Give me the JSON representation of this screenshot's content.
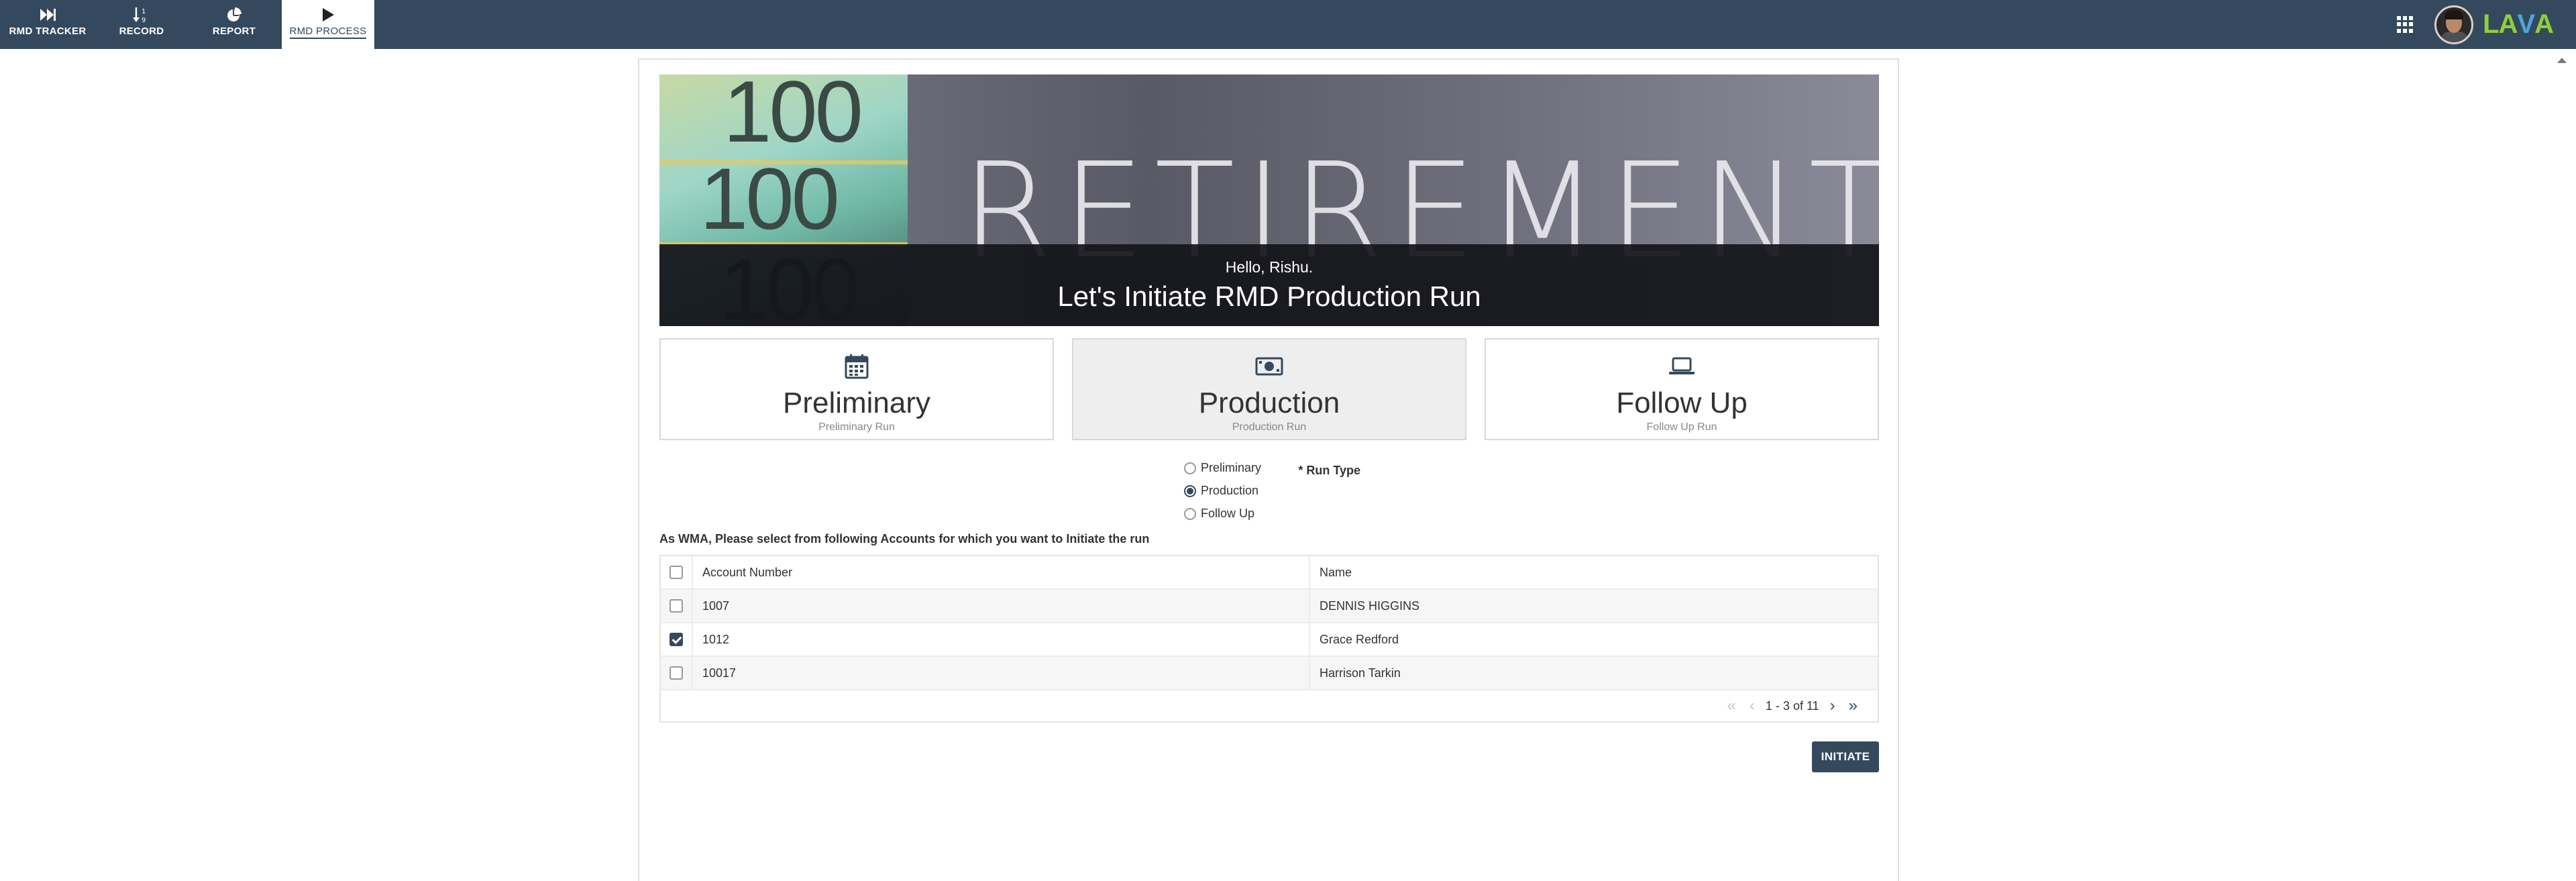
{
  "nav": {
    "items": [
      {
        "label": "RMD TRACKER",
        "icon": "fast-forward-icon"
      },
      {
        "label": "RECORD",
        "icon": "sort-icon"
      },
      {
        "label": "REPORT",
        "icon": "pie-chart-icon"
      },
      {
        "label": "RMD PROCESS",
        "icon": "play-icon",
        "active": true
      }
    ],
    "logo": {
      "main": "LA",
      "accent": "V",
      "tail": "A"
    }
  },
  "banner": {
    "image_text": "RETIREMENT",
    "money_numbers": [
      "100",
      "100",
      "100"
    ],
    "greeting": "Hello, Rishu.",
    "headline": "Let's Initiate RMD Production Run"
  },
  "phases": [
    {
      "title": "Preliminary",
      "subtitle": "Preliminary Run",
      "icon": "calendar-icon",
      "selected": false
    },
    {
      "title": "Production",
      "subtitle": "Production Run",
      "icon": "money-icon",
      "selected": true
    },
    {
      "title": "Follow Up",
      "subtitle": "Follow Up Run",
      "icon": "laptop-icon",
      "selected": false
    }
  ],
  "run_type": {
    "label": "* Run Type",
    "options": [
      {
        "label": "Preliminary",
        "checked": false
      },
      {
        "label": "Production",
        "checked": true
      },
      {
        "label": "Follow Up",
        "checked": false
      }
    ]
  },
  "instruction": "As WMA, Please select from following Accounts for which you want to Initiate the run",
  "table": {
    "headers": {
      "account": "Account Number",
      "name": "Name"
    },
    "rows": [
      {
        "account": "1007",
        "name": "DENNIS HIGGINS",
        "checked": false
      },
      {
        "account": "1012",
        "name": "Grace Redford",
        "checked": true
      },
      {
        "account": "10017",
        "name": "Harrison Tarkin",
        "checked": false
      }
    ],
    "pagination": {
      "text": "1 - 3 of 11"
    }
  },
  "initiate_label": "INITIATE",
  "colors": {
    "nav_bg": "#34495e",
    "accent": "#34495e",
    "logo_green": "#8fcf3a",
    "logo_blue": "#4aa8d8"
  }
}
